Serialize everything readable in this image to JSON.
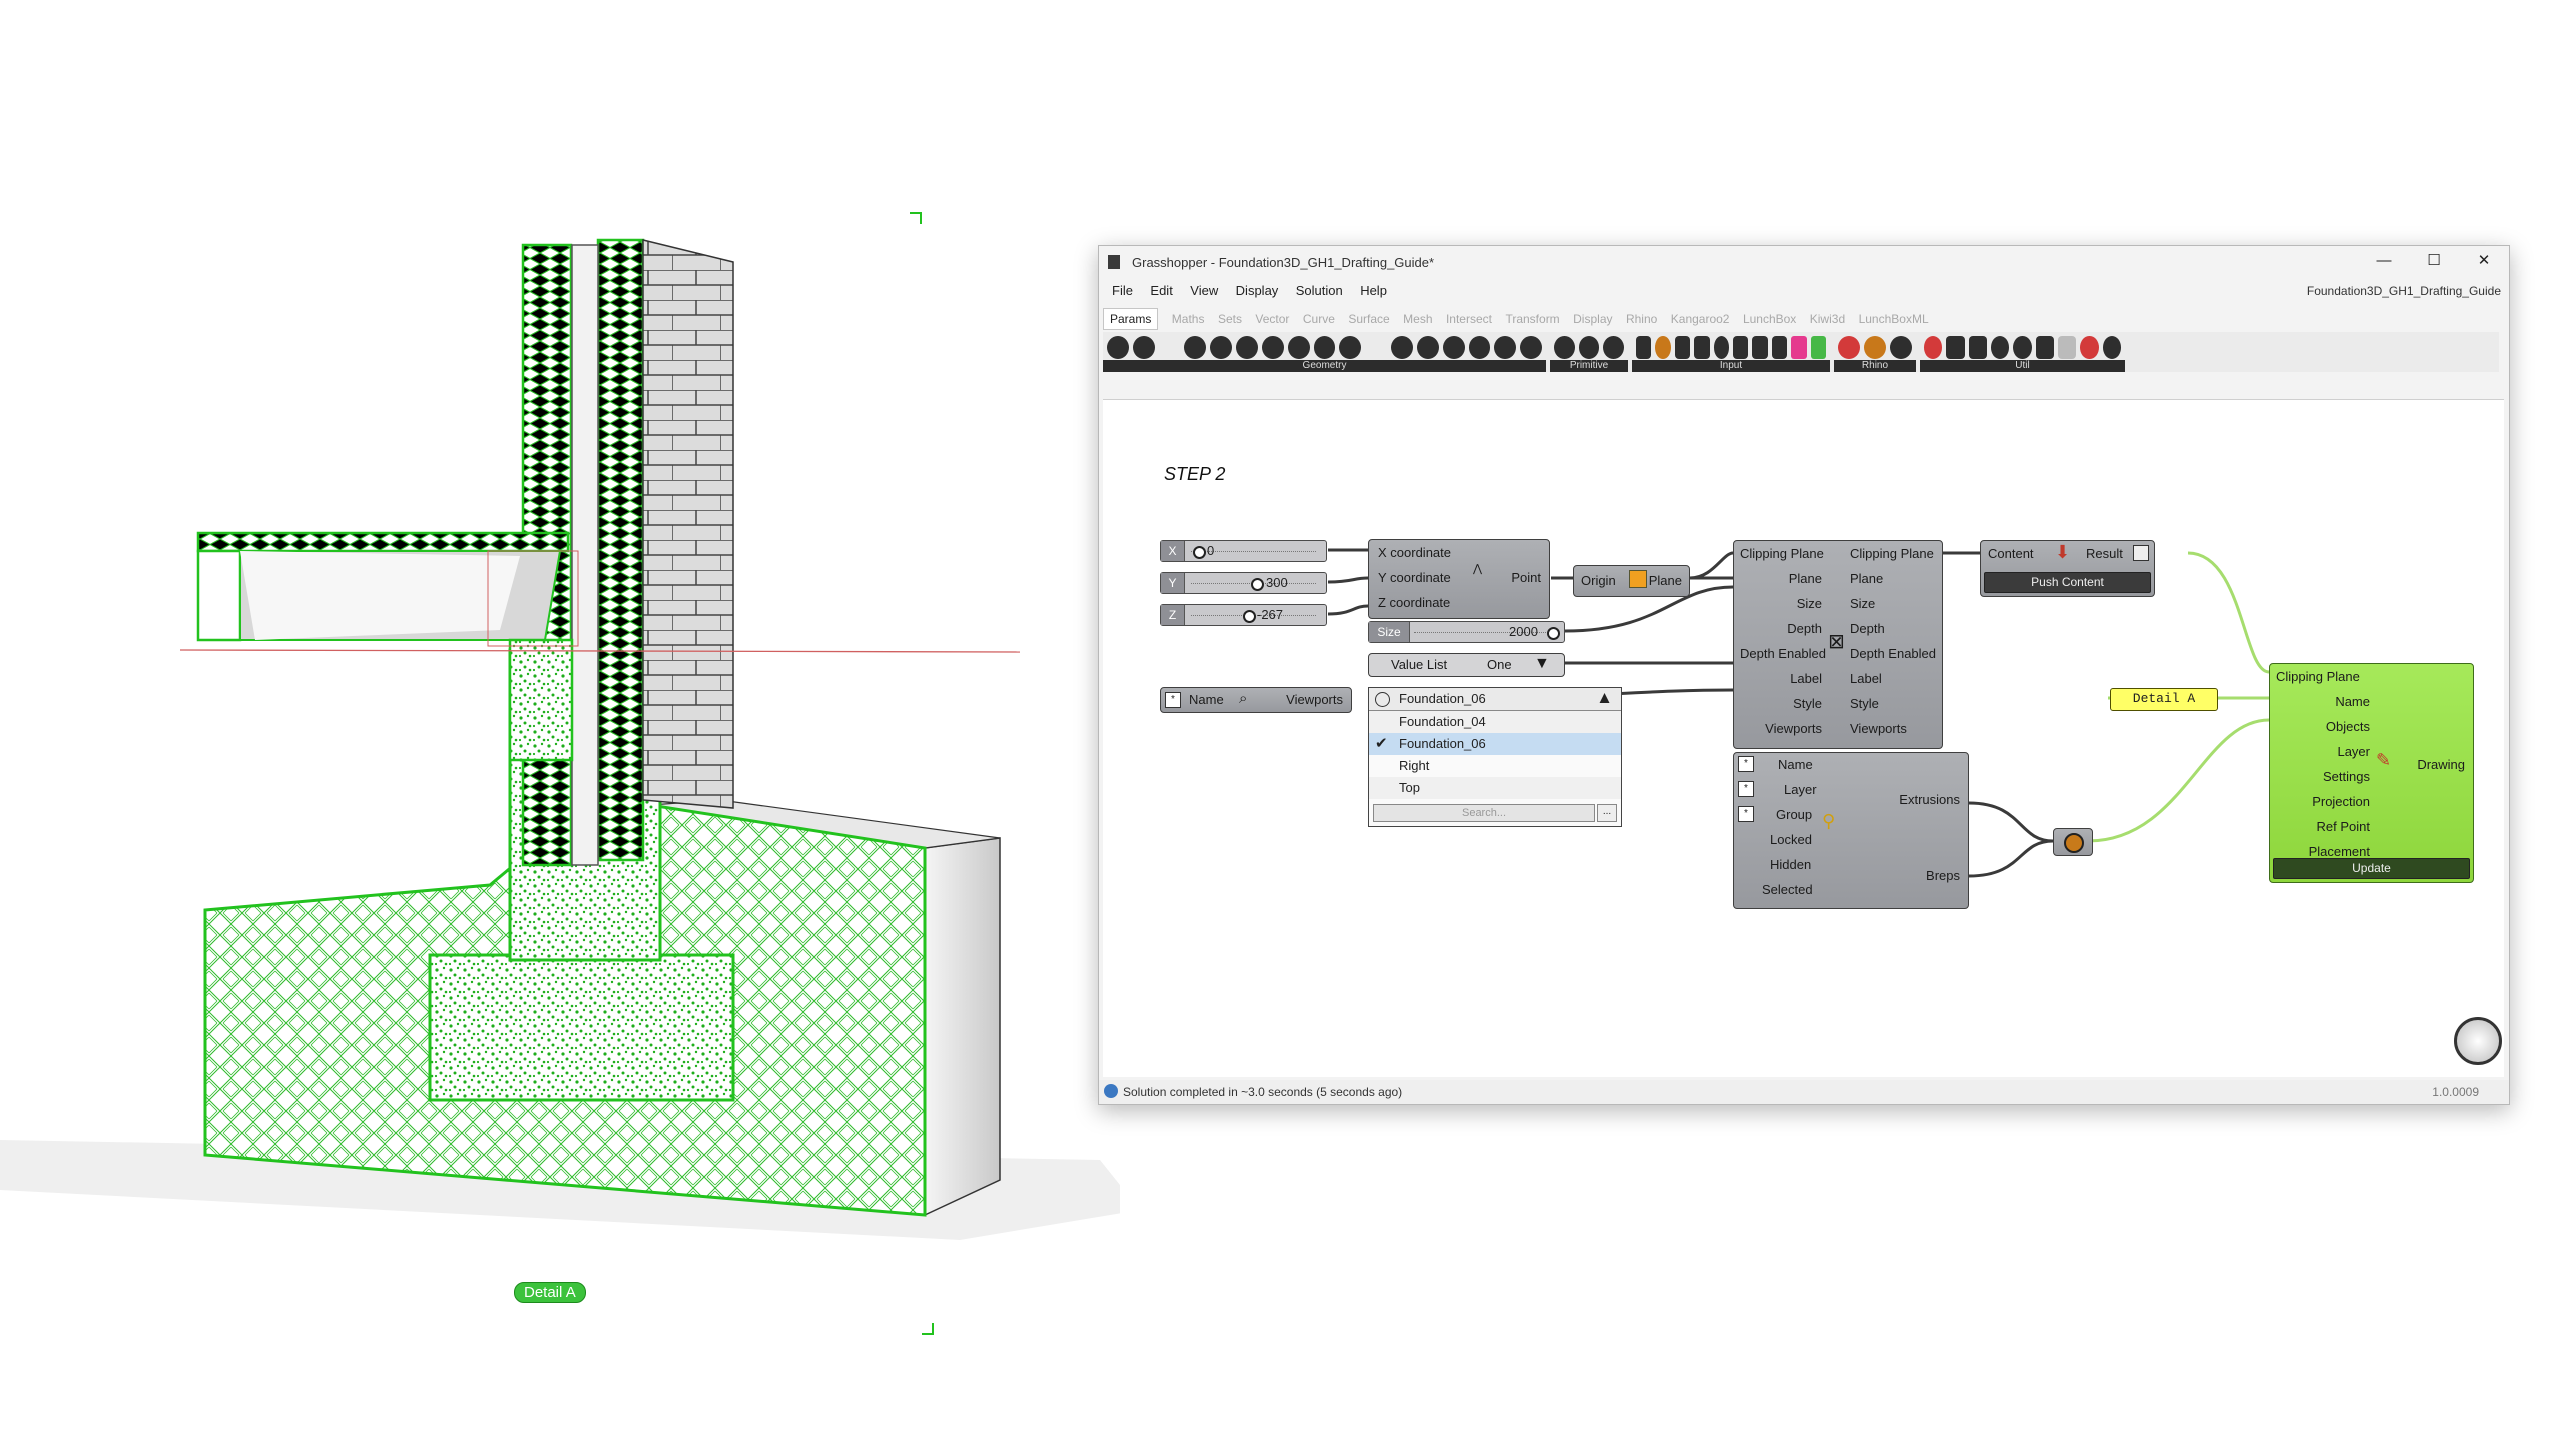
{
  "viewport": {
    "detail_tag": "Detail A"
  },
  "window": {
    "title": "Grasshopper - Foundation3D_GH1_Drafting_Guide*",
    "doc_name": "Foundation3D_GH1_Drafting_Guide",
    "min": "—",
    "max": "☐",
    "close": "✕"
  },
  "menu": [
    "File",
    "Edit",
    "View",
    "Display",
    "Solution",
    "Help"
  ],
  "tabs": [
    "Params",
    "Maths",
    "Sets",
    "Vector",
    "Curve",
    "Surface",
    "Mesh",
    "Intersect",
    "Transform",
    "Display",
    "Rhino",
    "Kangaroo2",
    "LunchBox",
    "Kiwi3d",
    "LunchBoxML"
  ],
  "toolbar_groups": [
    "Geometry",
    "Primitive",
    "Input",
    "Rhino",
    "Util"
  ],
  "canvas": {
    "step_label": "STEP 2",
    "sliders": [
      {
        "tag": "X",
        "value": "0"
      },
      {
        "tag": "Y",
        "value": "300"
      },
      {
        "tag": "Z",
        "value": "-267"
      }
    ],
    "construct_point": {
      "inputs": [
        "X coordinate",
        "Y coordinate",
        "Z coordinate"
      ],
      "output": "Point"
    },
    "xz_plane": {
      "input": "Origin",
      "output": "Plane"
    },
    "size_slider": {
      "tag": "Size",
      "value": "2000"
    },
    "value_list": {
      "label": "Value List",
      "value": "One"
    },
    "viewports": {
      "input": "Name",
      "output": "Viewports"
    },
    "viewport_list": {
      "selected": "Foundation_06",
      "options": [
        "Foundation_04",
        "Foundation_06",
        "Right",
        "Top"
      ],
      "search_placeholder": "Search..."
    },
    "clipping_plane": {
      "inputs": [
        "Clipping Plane",
        "Plane",
        "Size",
        "Depth",
        "Depth Enabled",
        "Label",
        "Style",
        "Viewports"
      ],
      "outputs": [
        "Clipping Plane",
        "Plane",
        "Size",
        "Depth",
        "Depth Enabled",
        "Label",
        "Style",
        "Viewports"
      ]
    },
    "push_content": {
      "input": "Content",
      "output": "Result",
      "button": "Push Content"
    },
    "query_objects": {
      "inputs": [
        "Name",
        "Layer",
        "Group",
        "Locked",
        "Hidden",
        "Selected"
      ],
      "outputs": [
        "Extrusions",
        "Breps"
      ]
    },
    "panel": "Detail A",
    "drawing": {
      "inputs": [
        "Clipping Plane",
        "Name",
        "Objects",
        "Layer",
        "Settings",
        "Projection",
        "Ref Point",
        "Placement"
      ],
      "output": "Drawing",
      "button": "Update"
    }
  },
  "status": {
    "text": "Solution completed in ~3.0 seconds (5 seconds ago)",
    "version": "1.0.0009"
  },
  "colors": {
    "section_green": "#22c21e",
    "component_grey": "#a3a5a9",
    "drawing_green": "#97e04a",
    "panel_yellow": "#ffff66"
  }
}
